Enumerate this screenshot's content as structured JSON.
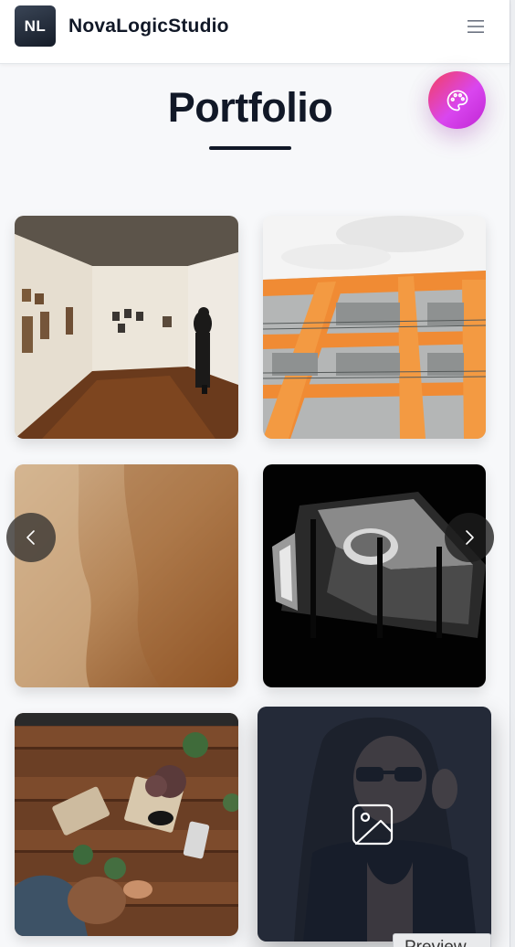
{
  "header": {
    "logo_text": "NL",
    "brand_name": "NovaLogicStudio",
    "menu_icon": "hamburger-menu-icon"
  },
  "theme_button": {
    "icon": "palette-icon",
    "accent_colors": [
      "#f43f5e",
      "#d946ef"
    ]
  },
  "page": {
    "title": "Portfolio"
  },
  "gallery": {
    "items": [
      {
        "subject": "art-gallery-photo"
      },
      {
        "subject": "orange-building-facade-photo"
      },
      {
        "subject": "sand-texture-photo"
      },
      {
        "subject": "dark-architecture-photo"
      },
      {
        "subject": "wooden-desk-flatlay-photo"
      },
      {
        "subject": "woman-sunglasses-photo",
        "hovered": true,
        "hover_icon": "image-icon"
      }
    ],
    "prev_icon": "chevron-left-icon",
    "next_icon": "chevron-right-icon"
  },
  "preview_tab": {
    "label": "Preview"
  }
}
